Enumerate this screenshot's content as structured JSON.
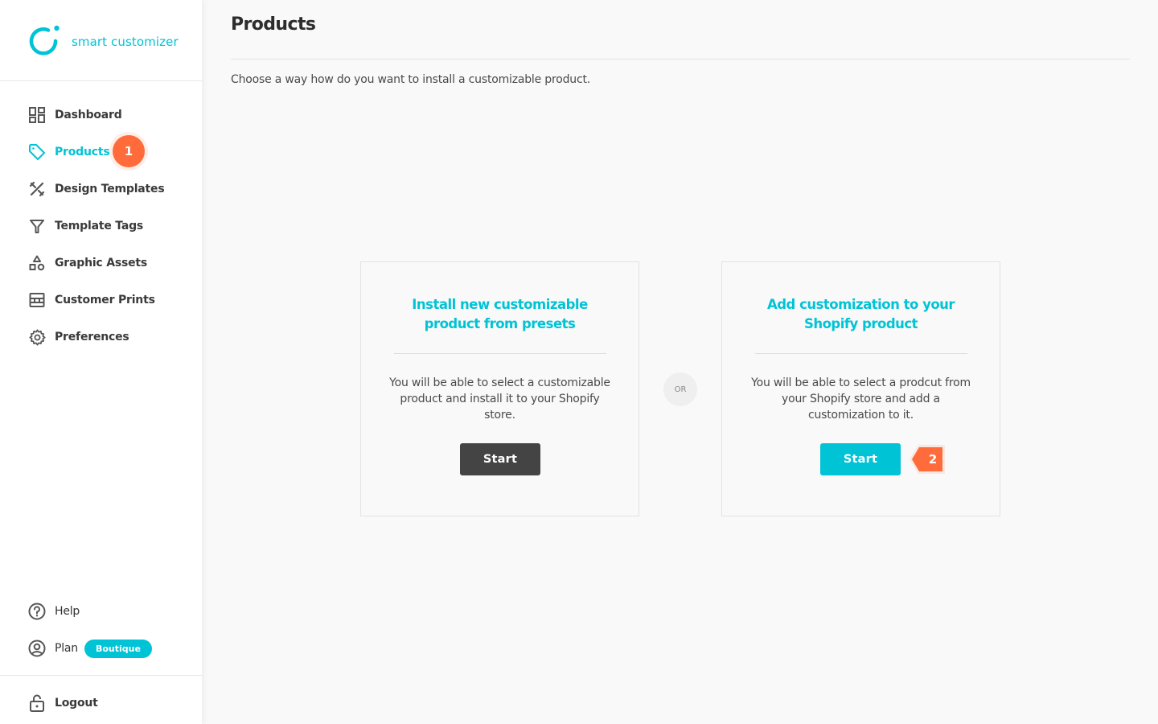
{
  "app": {
    "name": "smart customizer",
    "brand_color": "#00c3d6",
    "accent_color": "#ff6b3a"
  },
  "sidebar": {
    "items": [
      {
        "label": "Dashboard",
        "icon": "dashboard-icon",
        "active": false
      },
      {
        "label": "Products",
        "icon": "tag-icon",
        "active": true
      },
      {
        "label": "Design Templates",
        "icon": "design-tools-icon",
        "active": false
      },
      {
        "label": "Template Tags",
        "icon": "filter-icon",
        "active": false
      },
      {
        "label": "Graphic Assets",
        "icon": "shapes-icon",
        "active": false
      },
      {
        "label": "Customer Prints",
        "icon": "prints-icon",
        "active": false
      },
      {
        "label": "Preferences",
        "icon": "gear-icon",
        "active": false
      }
    ],
    "bottom": {
      "help": {
        "label": "Help",
        "icon": "help-circle-icon"
      },
      "plan": {
        "label": "Plan",
        "icon": "user-circle-icon",
        "badge": "Boutique"
      },
      "logout": {
        "label": "Logout",
        "icon": "lock-icon"
      }
    },
    "step_badge": "1"
  },
  "main": {
    "title": "Products",
    "subtitle": "Choose a way how do you want to install a customizable product.",
    "separator": "OR",
    "cards": [
      {
        "title": "Install new customizable product from presets",
        "description": "You will be able to select a customizable product and install it to your Shopify store.",
        "button": "Start"
      },
      {
        "title": "Add customization to your Shopify product",
        "description": "You will be able to select a prodcut from your Shopify store and add a customization to it.",
        "button": "Start",
        "step_badge": "2"
      }
    ]
  }
}
